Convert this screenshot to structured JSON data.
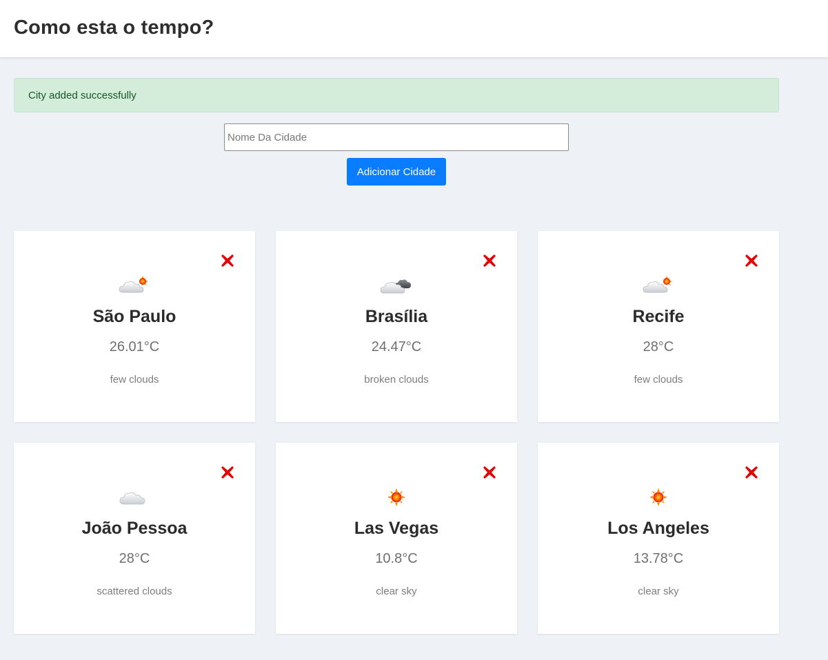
{
  "header": {
    "title": "Como esta o tempo?"
  },
  "alert": {
    "message": "City added successfully"
  },
  "form": {
    "placeholder": "Nome Da Cidade",
    "value": "",
    "button_label": "Adicionar Cidade"
  },
  "colors": {
    "accent": "#0a7cff",
    "alert_bg": "#d4edda",
    "close": "#e60000"
  },
  "cities": [
    {
      "name": "São Paulo",
      "temp": "26.01°C",
      "desc": "few clouds",
      "icon": "few-clouds-icon"
    },
    {
      "name": "Brasília",
      "temp": "24.47°C",
      "desc": "broken clouds",
      "icon": "broken-clouds-icon"
    },
    {
      "name": "Recife",
      "temp": "28°C",
      "desc": "few clouds",
      "icon": "few-clouds-icon"
    },
    {
      "name": "João Pessoa",
      "temp": "28°C",
      "desc": "scattered clouds",
      "icon": "scattered-clouds-icon"
    },
    {
      "name": "Las Vegas",
      "temp": "10.8°C",
      "desc": "clear sky",
      "icon": "clear-sky-icon"
    },
    {
      "name": "Los Angeles",
      "temp": "13.78°C",
      "desc": "clear sky",
      "icon": "clear-sky-icon"
    }
  ]
}
